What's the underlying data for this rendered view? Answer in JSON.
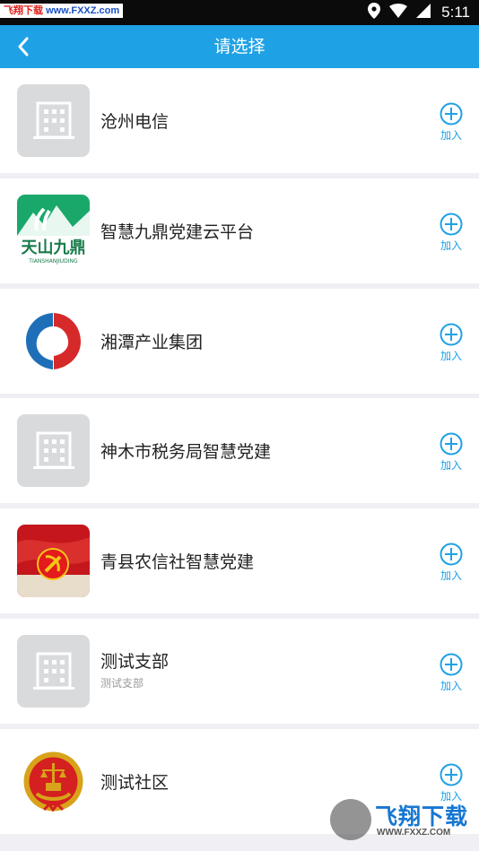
{
  "status_bar": {
    "watermark_site": "飞翔下载",
    "watermark_url": "www.FXXZ.com",
    "time": "5:11",
    "icons": [
      "location-icon",
      "wifi-icon",
      "signal-icon"
    ]
  },
  "app_bar": {
    "back_icon": "chevron-left-icon",
    "title": "请选择"
  },
  "add_label": "加入",
  "items": [
    {
      "name": "沧州电信",
      "subtitle": "",
      "logo": "building-placeholder-icon"
    },
    {
      "name": "智慧九鼎党建云平台",
      "subtitle": "",
      "logo": "tianshan-jiuding-logo",
      "logo_text": "天山九鼎",
      "logo_subtext": "TIANSHANJIUDING"
    },
    {
      "name": "湘潭产业集团",
      "subtitle": "",
      "logo": "xiangtan-group-logo"
    },
    {
      "name": "神木市税务局智慧党建",
      "subtitle": "",
      "logo": "building-placeholder-icon"
    },
    {
      "name": "青县农信社智慧党建",
      "subtitle": "",
      "logo": "party-emblem-logo"
    },
    {
      "name": "测试支部",
      "subtitle": "测试支部",
      "logo": "building-placeholder-icon"
    },
    {
      "name": "测试社区",
      "subtitle": "",
      "logo": "national-emblem-logo"
    }
  ],
  "bottom_watermark": {
    "text": "飞翔下载",
    "url": "WWW.FXXZ.COM"
  },
  "colors": {
    "primary": "#1fa1e6",
    "page_bg": "#efeff4",
    "placeholder": "#d9dadc"
  }
}
